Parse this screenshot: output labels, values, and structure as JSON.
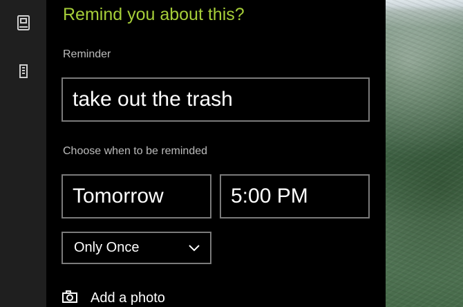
{
  "header": {
    "title": "Remind you about this?"
  },
  "reminder": {
    "label": "Reminder",
    "value": "take out the trash"
  },
  "schedule": {
    "label": "Choose when to be reminded",
    "date": "Tomorrow",
    "time": "5:00 PM",
    "repeat": "Only Once"
  },
  "photo": {
    "label": "Add a photo"
  },
  "icons": {
    "rail_top": "notebook-icon",
    "rail_second": "building-icon",
    "camera": "camera-icon"
  },
  "colors": {
    "accent": "#a6ce39",
    "panel_bg": "#000000",
    "rail_bg": "#1f1f1f",
    "border": "#7b7b7b"
  }
}
